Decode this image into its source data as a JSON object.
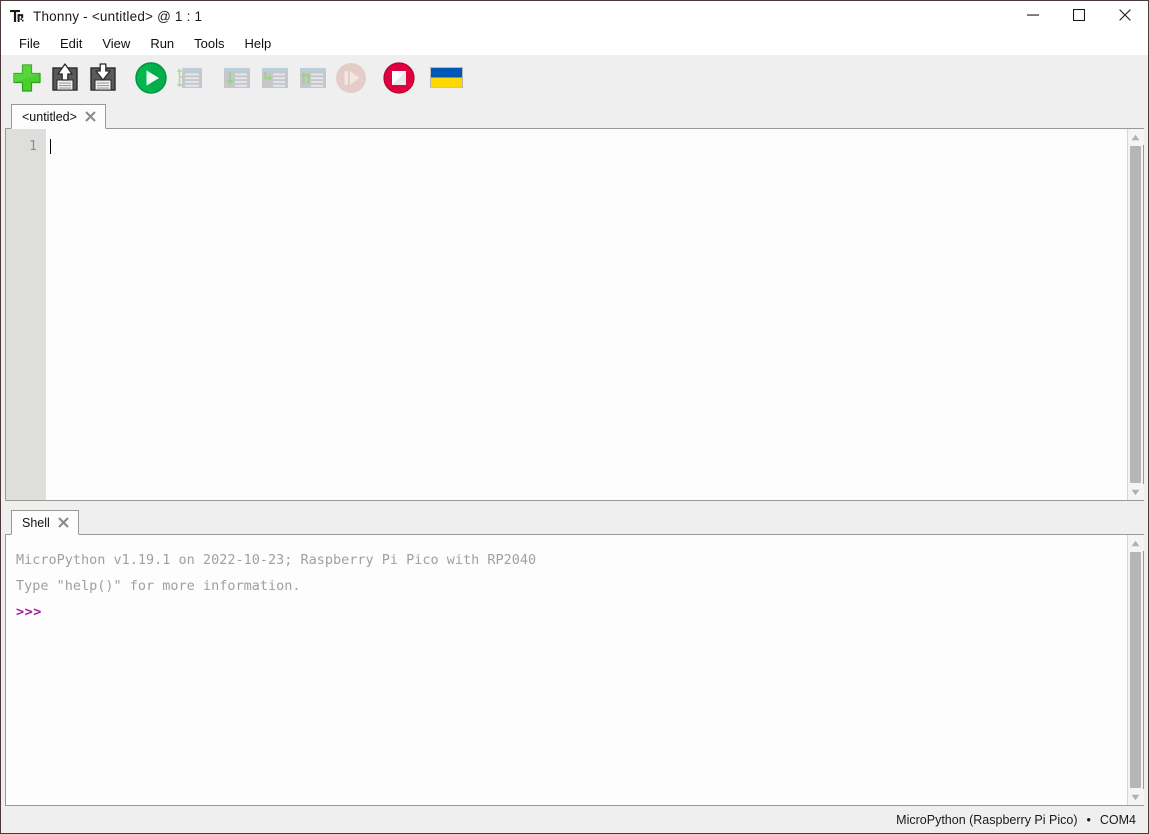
{
  "window": {
    "title": "Thonny  -  <untitled>  @  1 : 1",
    "app_icon": "thonny-logo-icon",
    "controls": {
      "minimize": "minimize-icon",
      "maximize": "maximize-icon",
      "close": "close-icon"
    }
  },
  "menubar": {
    "items": [
      {
        "label": "File"
      },
      {
        "label": "Edit"
      },
      {
        "label": "View"
      },
      {
        "label": "Run"
      },
      {
        "label": "Tools"
      },
      {
        "label": "Help"
      }
    ]
  },
  "toolbar": {
    "buttons": [
      {
        "name": "new-file-button",
        "icon": "plus-icon",
        "enabled": true
      },
      {
        "name": "open-file-button",
        "icon": "floppy-up-arrow-icon",
        "enabled": true
      },
      {
        "name": "save-file-button",
        "icon": "floppy-down-arrow-icon",
        "enabled": true
      },
      {
        "name": "run-button",
        "icon": "play-circle-icon",
        "enabled": true
      },
      {
        "name": "debug-button",
        "icon": "debug-step-icon",
        "enabled": false
      },
      {
        "name": "step-over-button",
        "icon": "step-over-icon",
        "enabled": false
      },
      {
        "name": "step-into-button",
        "icon": "step-into-icon",
        "enabled": false
      },
      {
        "name": "step-out-button",
        "icon": "step-out-icon",
        "enabled": false
      },
      {
        "name": "resume-button",
        "icon": "resume-circle-icon",
        "enabled": false
      },
      {
        "name": "stop-button",
        "icon": "stop-circle-icon",
        "enabled": true
      },
      {
        "name": "ukraine-flag-button",
        "icon": "ukraine-flag-icon",
        "enabled": true
      }
    ]
  },
  "editor": {
    "tab_label": "<untitled>",
    "tab_close_icon": "close-tab-icon",
    "line_numbers": [
      "1"
    ],
    "code_lines": [
      ""
    ]
  },
  "shell": {
    "tab_label": "Shell",
    "tab_close_icon": "close-tab-icon",
    "lines": [
      "MicroPython v1.19.1 on 2022-10-23; Raspberry Pi Pico with RP2040",
      "Type \"help()\" for more information."
    ],
    "prompt": ">>>"
  },
  "statusbar": {
    "interpreter": "MicroPython (Raspberry Pi Pico)",
    "separator": "•",
    "port": "COM4"
  },
  "colors": {
    "accent_green": "#45c13a",
    "run_green": "#00b050",
    "stop_red": "#e00040",
    "prompt_purple": "#a020a0",
    "flag_blue": "#0057b7",
    "flag_yellow": "#ffd700",
    "toolbar_bg": "#efefef",
    "editor_bg": "#fdfdfd",
    "gutter_bg": "#dededc"
  }
}
